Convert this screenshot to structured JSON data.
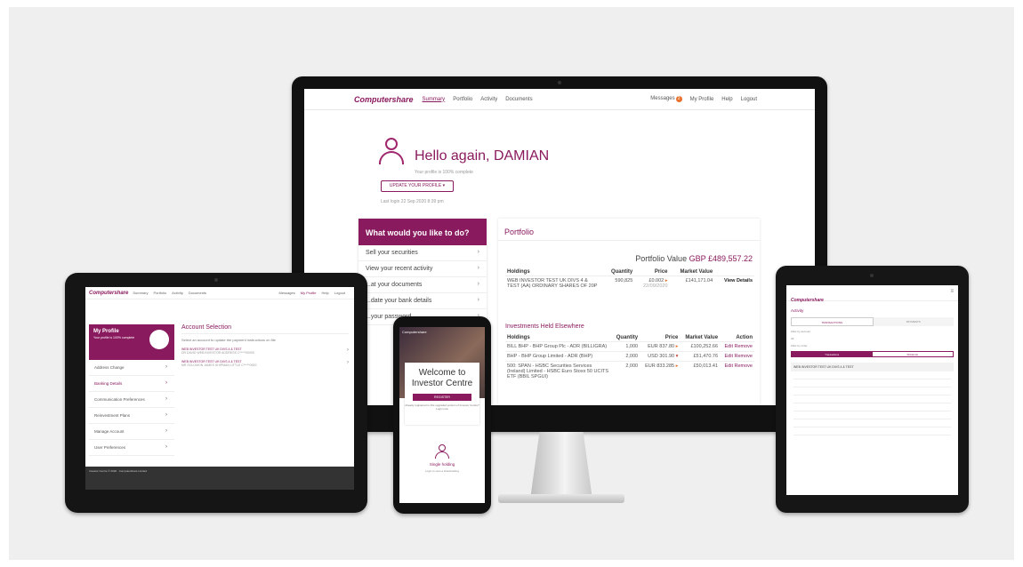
{
  "desktop": {
    "nav": {
      "logo": "Computershare",
      "items": [
        "Summary",
        "Portfolio",
        "Activity",
        "Documents"
      ],
      "right": {
        "messages": "Messages",
        "badge": "2",
        "profile": "My Profile",
        "help": "Help",
        "logout": "Logout"
      }
    },
    "greeting": "Hello again, DAMIAN",
    "completion": "Your profile is 100% complete",
    "update_button": "UPDATE YOUR PROFILE",
    "last_login": "Last login 22 Sep 2020 8:39 pm",
    "todo": {
      "title": "What would you like to do?",
      "items": [
        "Sell your securities",
        "View your recent activity",
        "...at your documents",
        "...date your bank details",
        "...your password"
      ]
    },
    "portfolio": {
      "title": "Portfolio",
      "value_label": "Portfolio Value",
      "value": "GBP £489,557.22",
      "holdings_headers": [
        "Holdings",
        "Quantity",
        "Price",
        "Market Value"
      ],
      "holdings_rows": [
        {
          "name": "WEB INVESTOR TEST UK DIVS 4 & TEST (AA) ORDINARY SHARES OF 20P",
          "qty": "590,825",
          "price": "£0.002",
          "date": "22/09/2020",
          "value": "£141,171.04",
          "action": "View Details"
        }
      ],
      "elsewhere_title": "Investments Held Elsewhere",
      "elsewhere_headers": [
        "Holdings",
        "Quantity",
        "Price",
        "Market Value",
        "Action"
      ],
      "elsewhere_rows": [
        {
          "name": "BILL BHP - BHP Group Plc - ADR (BILLIGRA)",
          "qty": "1,000",
          "price": "EUR 837.80",
          "value": "£100,252.66",
          "action": "Edit Remove"
        },
        {
          "name": "BHP - BHP Group Limited - ADR (BHP)",
          "qty": "2,000",
          "price": "USD 301.90",
          "value": "£51,470.76",
          "action": "Edit Remove"
        },
        {
          "name": "500: SPAN - HSBC Securities Services (Ireland) Limited - HSBC Euro Stoxx 50 UCITS ETF (BBIL SPGUI)",
          "qty": "2,000",
          "price": "EUR 833.285",
          "value": "£50,013.41",
          "action": "Edit Remove"
        }
      ]
    }
  },
  "tablet": {
    "nav": {
      "logo": "Computershare",
      "items": [
        "Summary",
        "Portfolio",
        "Activity",
        "Documents"
      ],
      "right": [
        "Messages",
        "My Profile",
        "Help",
        "Logout"
      ]
    },
    "profile": {
      "title": "My Profile",
      "subtitle": "Your profile is 100% complete",
      "items": [
        "Address Change",
        "Banking Details",
        "Communication Preferences",
        "Reinvestment Plans",
        "Manage Account",
        "User Preferences"
      ]
    },
    "account": {
      "title": "Account Selection",
      "desc": "Select an account to update the payment instructions on file",
      "rows": [
        {
          "label": "WEB INVESTOR TEST UK DIVS 4 & TEST",
          "sub": "DR DAVID WEB INVESTOR ADDRESS C*****00000"
        },
        {
          "label": "WEB INVESTOR TEST UK DIVS 4 & TEST",
          "sub": "MR SOLOMON JAMES SHIPMAN LITTLE C*****0000"
        }
      ]
    },
    "footer": "Investor Centre  © 2020 · Computershare Limited"
  },
  "phone": {
    "bar": "Computershare",
    "welcome": "Welcome to Investor Centre",
    "button": "REGISTER",
    "note": "Already registered to this upgraded version of Investor Centre? Login now",
    "single": "Single holding",
    "single_sub": "Login to view a shareholding"
  },
  "tablet2": {
    "logo": "Computershare",
    "title": "Activity",
    "tabs": [
      "TRANSACTIONS",
      "PAYMENTS"
    ],
    "filter_label": "Filter by account",
    "filter_value": "All",
    "order_label": "Filter by order",
    "toggle": [
      "Transactions",
      "Dividends"
    ],
    "account": "WEB INVESTOR TEST UK DIVS 4 & TEST"
  }
}
